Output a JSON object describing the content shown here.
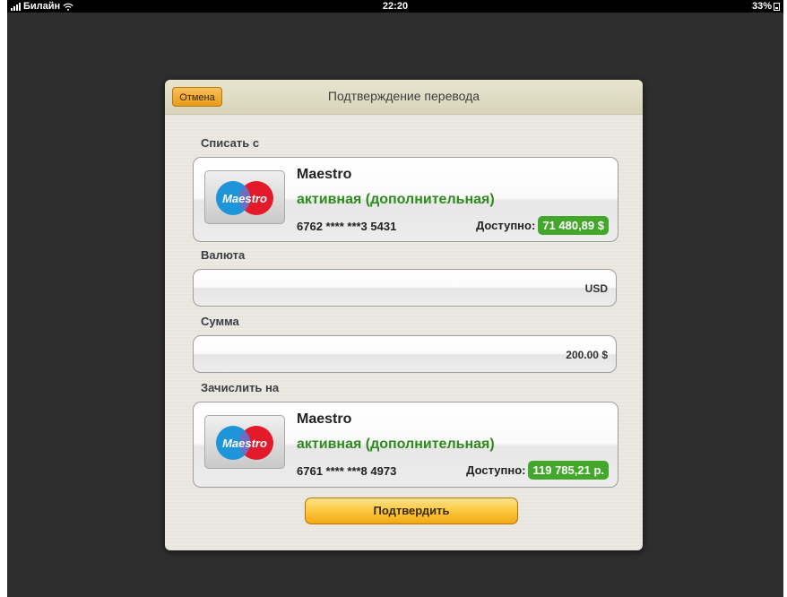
{
  "status_bar": {
    "carrier": "Билайн",
    "time": "22:20",
    "battery": "33%"
  },
  "dialog": {
    "title": "Подтверждение перевода",
    "cancel_label": "Отмена",
    "from_label": "Списать с",
    "from_card": {
      "logo_text": "Maestro",
      "name": "Maestro",
      "status": "активная (дополнительная)",
      "number": "6762 **** ***3 5431",
      "available_label": "Доступно:",
      "available_amount": "71 480,89 $"
    },
    "currency_label": "Валюта",
    "currency_value": "USD",
    "amount_label": "Сумма",
    "amount_value": "200.00 $",
    "to_label": "Зачислить на",
    "to_card": {
      "logo_text": "Maestro",
      "name": "Maestro",
      "status": "активная (дополнительная)",
      "number": "6761 **** ***8 4973",
      "available_label": "Доступно:",
      "available_amount": "119 785,21 р."
    },
    "confirm_label": "Подтвердить"
  },
  "colors": {
    "status_green": "#2e8b1d",
    "badge_green": "#43a72c",
    "button_orange": "#fbc83e",
    "backdrop": "#2e2e2e"
  }
}
